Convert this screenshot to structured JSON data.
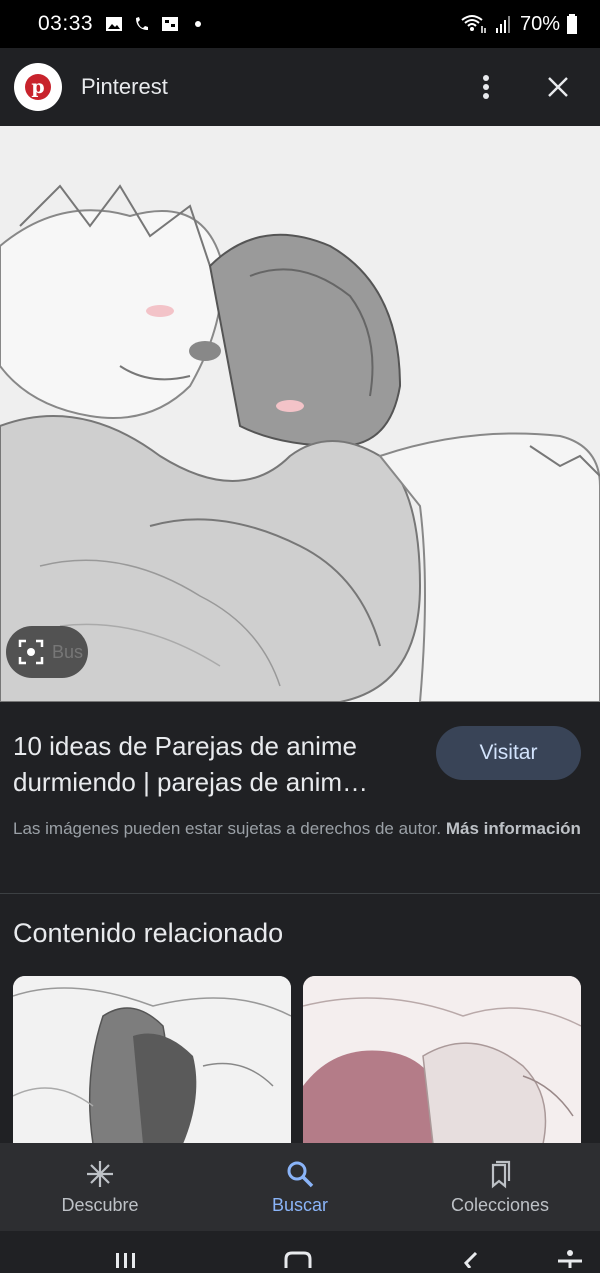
{
  "status_bar": {
    "time": "03:33",
    "battery": "70%"
  },
  "appbar": {
    "title": "Pinterest",
    "logo_letter": "p"
  },
  "image_lens": {
    "chip_text": "Bus"
  },
  "result": {
    "title": "10 ideas de Parejas de anime durmiendo | parejas de anim…",
    "visit_label": "Visitar",
    "copyright_text": "Las imágenes pueden estar sujetas a derechos de autor. ",
    "more_info_label": "Más información"
  },
  "related": {
    "title": "Contenido relacionado"
  },
  "bottom_nav": {
    "items": [
      {
        "label": "Descubre",
        "icon": "asterisk-icon"
      },
      {
        "label": "Buscar",
        "icon": "search-icon",
        "active": true
      },
      {
        "label": "Colecciones",
        "icon": "bookmark-icon"
      }
    ]
  },
  "colors": {
    "accent": "#8ab4f8",
    "pinterest_red": "#c8232c",
    "visit_button_bg": "#394457"
  }
}
